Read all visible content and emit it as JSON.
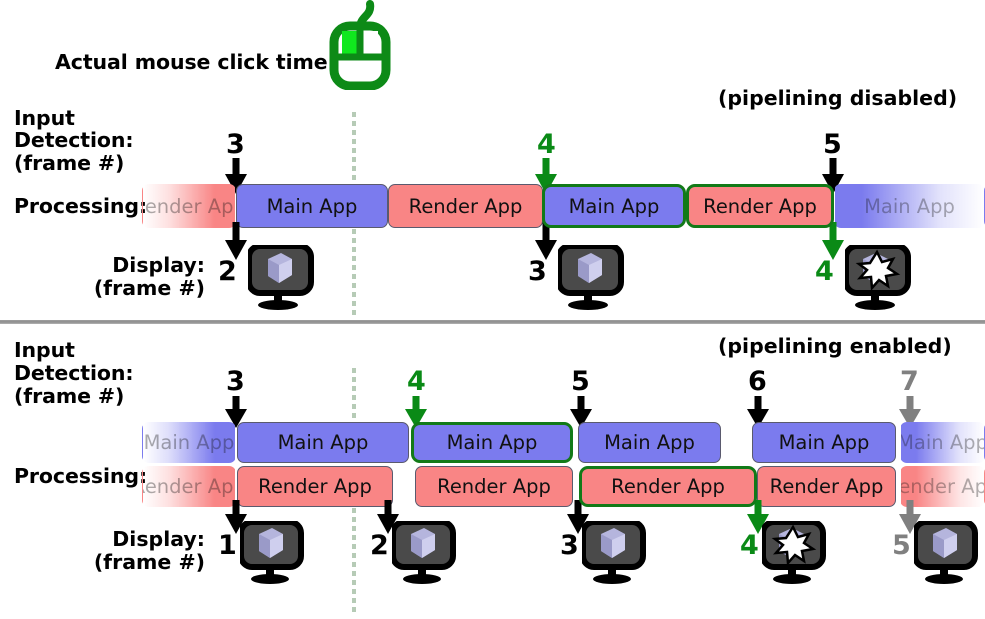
{
  "diagram": {
    "title_note_top": "(pipelining disabled)",
    "title_note_bottom": "(pipelining enabled)",
    "click_label": "Actual mouse click time:",
    "mouse_icon": "mouse-icon",
    "accent_green": "#127a18",
    "arrow_black": "#000000",
    "arrow_gray": "#808080",
    "color_main_app": "#7b7bee",
    "color_render_app": "#f98585",
    "clickline_color": "#b6cbb6",
    "divider_color": "#9a9a9a"
  },
  "row_labels": {
    "input_l1": "Input",
    "input_l2": "Detection:",
    "input_l3": "(frame #)",
    "processing": "Processing:",
    "display_l1": "Display:",
    "display_l2": "(frame #)"
  },
  "labels_main": "Main App",
  "labels_render": "Render App",
  "top_section": {
    "input_arrows": [
      {
        "label": "3",
        "color": "black"
      },
      {
        "label": "4",
        "color": "green"
      },
      {
        "label": "5",
        "color": "black"
      }
    ],
    "bars": [
      {
        "type": "render",
        "label": "Render App",
        "fade": "left",
        "highlight": false
      },
      {
        "type": "main",
        "label": "Main App",
        "fade": "none",
        "highlight": false
      },
      {
        "type": "render",
        "label": "Render App",
        "fade": "none",
        "highlight": false
      },
      {
        "type": "main",
        "label": "Main App",
        "fade": "none",
        "highlight": true
      },
      {
        "type": "render",
        "label": "Render App",
        "fade": "none",
        "highlight": true
      },
      {
        "type": "main",
        "label": "Main App",
        "fade": "right",
        "highlight": false
      }
    ],
    "display": [
      {
        "label": "2",
        "color": "black",
        "icon": "monitor-cube-icon"
      },
      {
        "label": "3",
        "color": "black",
        "icon": "monitor-cube-icon"
      },
      {
        "label": "4",
        "color": "green",
        "icon": "monitor-cube-star-icon"
      }
    ]
  },
  "bottom_section": {
    "input_arrows": [
      {
        "label": "3",
        "color": "black"
      },
      {
        "label": "4",
        "color": "green"
      },
      {
        "label": "5",
        "color": "black"
      },
      {
        "label": "6",
        "color": "black"
      },
      {
        "label": "7",
        "color": "gray"
      }
    ],
    "main_bars": [
      {
        "label": "Main App",
        "fade": "left",
        "highlight": false
      },
      {
        "label": "Main App",
        "fade": "none",
        "highlight": false
      },
      {
        "label": "Main App",
        "fade": "none",
        "highlight": true
      },
      {
        "label": "Main App",
        "fade": "none",
        "highlight": false
      },
      {
        "label": "Main App",
        "fade": "none",
        "highlight": false
      },
      {
        "label": "Main App",
        "fade": "right",
        "highlight": false
      }
    ],
    "render_bars": [
      {
        "label": "Render App",
        "fade": "left",
        "highlight": false
      },
      {
        "label": "Render App",
        "fade": "none",
        "highlight": false
      },
      {
        "label": "Render App",
        "fade": "none",
        "highlight": false
      },
      {
        "label": "Render App",
        "fade": "none",
        "highlight": true
      },
      {
        "label": "Render App",
        "fade": "none",
        "highlight": false
      },
      {
        "label": "Render App",
        "fade": "right",
        "highlight": false
      }
    ],
    "display": [
      {
        "label": "1",
        "color": "black",
        "icon": "monitor-cube-icon"
      },
      {
        "label": "2",
        "color": "black",
        "icon": "monitor-cube-icon"
      },
      {
        "label": "3",
        "color": "black",
        "icon": "monitor-cube-icon"
      },
      {
        "label": "4",
        "color": "green",
        "icon": "monitor-cube-star-icon"
      },
      {
        "label": "5",
        "color": "gray",
        "icon": "monitor-cube-icon"
      }
    ]
  }
}
